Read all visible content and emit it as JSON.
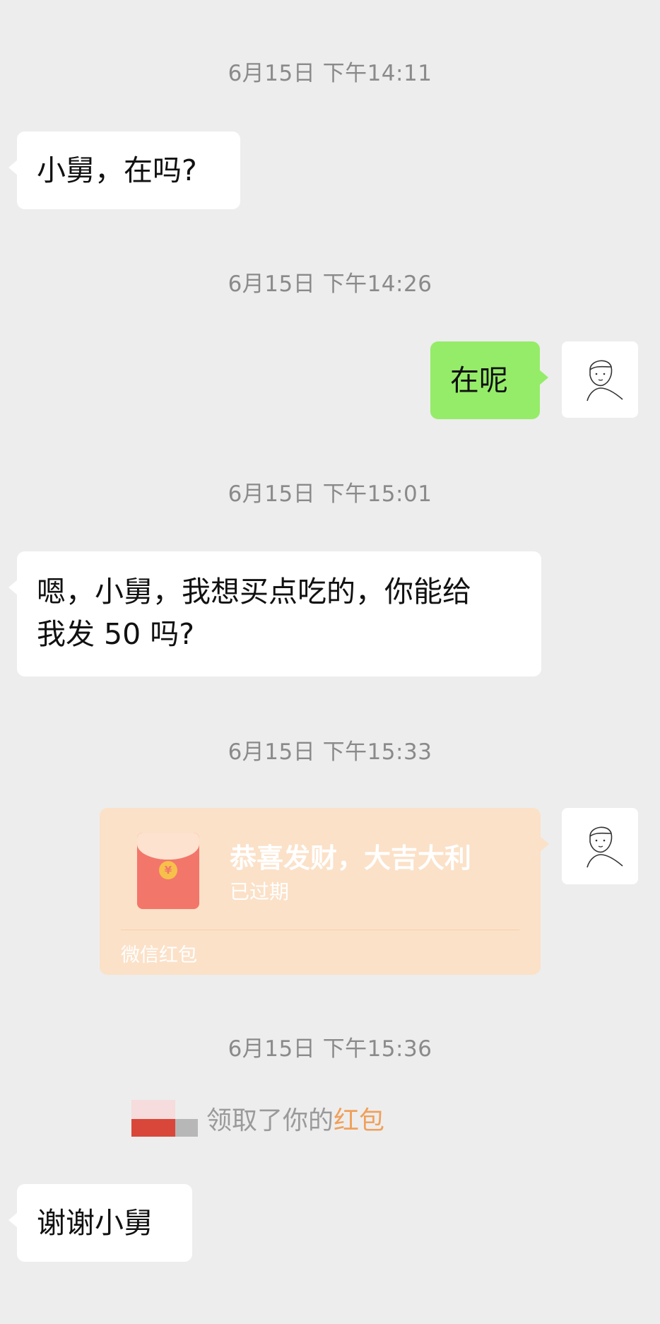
{
  "chat": {
    "messages": [
      {
        "timestamp": "6月15日 下午14:11",
        "text": "小舅，在吗?"
      },
      {
        "timestamp": "6月15日 下午14:26",
        "text": "在呢"
      },
      {
        "timestamp": "6月15日 下午15:01",
        "line1": "嗯，小舅，我想买点吃的，你能给",
        "line2": "我发 50 吗?"
      },
      {
        "timestamp": "6月15日 下午15:33"
      },
      {
        "timestamp": "6月15日 下午15:36"
      },
      {
        "text": "谢谢小舅"
      }
    ],
    "red_packet": {
      "title": "恭喜发财，大吉大利",
      "status": "已过期",
      "footer": "微信红包",
      "icon": "yuan-coin-icon"
    },
    "system_notice": {
      "text": "领取了你的",
      "link": "红包"
    }
  },
  "colors": {
    "background": "#ededed",
    "incoming_bubble": "#ffffff",
    "outgoing_bubble": "#95ec69",
    "red_packet_bg": "#fbe1c8",
    "link": "#f0a05a",
    "timestamp": "#8a8a8a"
  }
}
